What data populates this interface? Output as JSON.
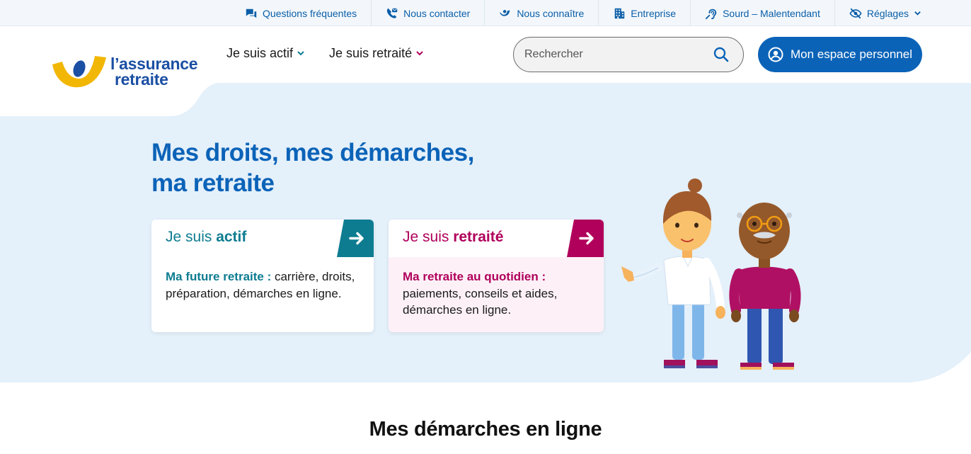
{
  "topbar": {
    "items": [
      {
        "label": "Questions fréquentes",
        "icon": "chat-icon"
      },
      {
        "label": "Nous contacter",
        "icon": "contact-icon"
      },
      {
        "label": "Nous connaître",
        "icon": "brand-icon"
      },
      {
        "label": "Entreprise",
        "icon": "building-icon"
      },
      {
        "label": "Sourd – Malentendant",
        "icon": "ear-icon"
      },
      {
        "label": "Réglages",
        "icon": "eye-off-icon"
      }
    ]
  },
  "logo": {
    "line1": "l’assurance",
    "line2": "retraite"
  },
  "nav": {
    "items": [
      {
        "label": "Je suis actif",
        "color": "#0d7c91"
      },
      {
        "label": "Je suis retraité",
        "color": "#b0005b"
      }
    ]
  },
  "search": {
    "placeholder": "Rechercher"
  },
  "account": {
    "label": "Mon espace personnel"
  },
  "hero": {
    "title_line1": "Mes droits, mes démarches,",
    "title_line2": "ma retraite",
    "cards": [
      {
        "head_prefix": "Je suis ",
        "head_bold": "actif",
        "body_strong": "Ma future retraite :",
        "body_text": " carrière, droits, préparation, démarches en ligne.",
        "accent": "#0d7c91"
      },
      {
        "head_prefix": "Je suis ",
        "head_bold": "retraité",
        "body_strong": "Ma retraite au quotidien :",
        "body_text": " paiements, conseils et aides, démarches en ligne.",
        "accent": "#b0005b"
      }
    ]
  },
  "section": {
    "title": "Mes démarches en ligne"
  },
  "colors": {
    "primary": "#0b63b8",
    "hero_bg": "#e4f0fa",
    "actif": "#0d7c91",
    "retraite": "#b0005b",
    "logo_yellow": "#f2b705",
    "logo_blue": "#1b4fa3"
  }
}
